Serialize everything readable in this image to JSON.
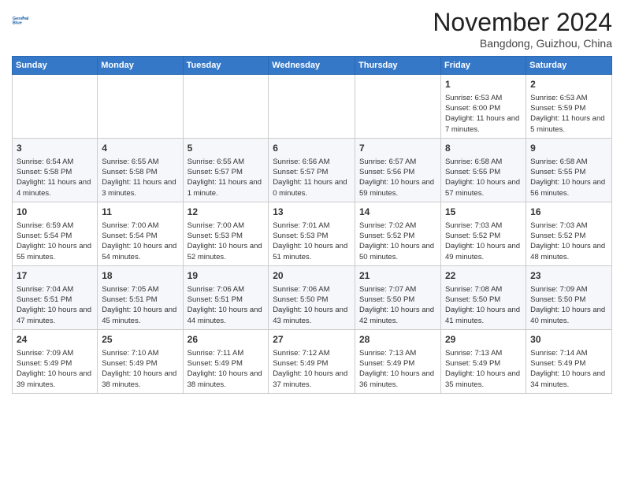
{
  "logo": {
    "line1": "General",
    "line2": "Blue"
  },
  "title": "November 2024",
  "location": "Bangdong, Guizhou, China",
  "weekdays": [
    "Sunday",
    "Monday",
    "Tuesday",
    "Wednesday",
    "Thursday",
    "Friday",
    "Saturday"
  ],
  "weeks": [
    [
      {
        "day": "",
        "empty": true
      },
      {
        "day": "",
        "empty": true
      },
      {
        "day": "",
        "empty": true
      },
      {
        "day": "",
        "empty": true
      },
      {
        "day": "",
        "empty": true
      },
      {
        "day": "1",
        "sunrise": "6:53 AM",
        "sunset": "6:00 PM",
        "daylight": "11 hours and 7 minutes."
      },
      {
        "day": "2",
        "sunrise": "6:53 AM",
        "sunset": "5:59 PM",
        "daylight": "11 hours and 5 minutes."
      }
    ],
    [
      {
        "day": "3",
        "sunrise": "6:54 AM",
        "sunset": "5:58 PM",
        "daylight": "11 hours and 4 minutes."
      },
      {
        "day": "4",
        "sunrise": "6:55 AM",
        "sunset": "5:58 PM",
        "daylight": "11 hours and 3 minutes."
      },
      {
        "day": "5",
        "sunrise": "6:55 AM",
        "sunset": "5:57 PM",
        "daylight": "11 hours and 1 minute."
      },
      {
        "day": "6",
        "sunrise": "6:56 AM",
        "sunset": "5:57 PM",
        "daylight": "11 hours and 0 minutes."
      },
      {
        "day": "7",
        "sunrise": "6:57 AM",
        "sunset": "5:56 PM",
        "daylight": "10 hours and 59 minutes."
      },
      {
        "day": "8",
        "sunrise": "6:58 AM",
        "sunset": "5:55 PM",
        "daylight": "10 hours and 57 minutes."
      },
      {
        "day": "9",
        "sunrise": "6:58 AM",
        "sunset": "5:55 PM",
        "daylight": "10 hours and 56 minutes."
      }
    ],
    [
      {
        "day": "10",
        "sunrise": "6:59 AM",
        "sunset": "5:54 PM",
        "daylight": "10 hours and 55 minutes."
      },
      {
        "day": "11",
        "sunrise": "7:00 AM",
        "sunset": "5:54 PM",
        "daylight": "10 hours and 54 minutes."
      },
      {
        "day": "12",
        "sunrise": "7:00 AM",
        "sunset": "5:53 PM",
        "daylight": "10 hours and 52 minutes."
      },
      {
        "day": "13",
        "sunrise": "7:01 AM",
        "sunset": "5:53 PM",
        "daylight": "10 hours and 51 minutes."
      },
      {
        "day": "14",
        "sunrise": "7:02 AM",
        "sunset": "5:52 PM",
        "daylight": "10 hours and 50 minutes."
      },
      {
        "day": "15",
        "sunrise": "7:03 AM",
        "sunset": "5:52 PM",
        "daylight": "10 hours and 49 minutes."
      },
      {
        "day": "16",
        "sunrise": "7:03 AM",
        "sunset": "5:52 PM",
        "daylight": "10 hours and 48 minutes."
      }
    ],
    [
      {
        "day": "17",
        "sunrise": "7:04 AM",
        "sunset": "5:51 PM",
        "daylight": "10 hours and 47 minutes."
      },
      {
        "day": "18",
        "sunrise": "7:05 AM",
        "sunset": "5:51 PM",
        "daylight": "10 hours and 45 minutes."
      },
      {
        "day": "19",
        "sunrise": "7:06 AM",
        "sunset": "5:51 PM",
        "daylight": "10 hours and 44 minutes."
      },
      {
        "day": "20",
        "sunrise": "7:06 AM",
        "sunset": "5:50 PM",
        "daylight": "10 hours and 43 minutes."
      },
      {
        "day": "21",
        "sunrise": "7:07 AM",
        "sunset": "5:50 PM",
        "daylight": "10 hours and 42 minutes."
      },
      {
        "day": "22",
        "sunrise": "7:08 AM",
        "sunset": "5:50 PM",
        "daylight": "10 hours and 41 minutes."
      },
      {
        "day": "23",
        "sunrise": "7:09 AM",
        "sunset": "5:50 PM",
        "daylight": "10 hours and 40 minutes."
      }
    ],
    [
      {
        "day": "24",
        "sunrise": "7:09 AM",
        "sunset": "5:49 PM",
        "daylight": "10 hours and 39 minutes."
      },
      {
        "day": "25",
        "sunrise": "7:10 AM",
        "sunset": "5:49 PM",
        "daylight": "10 hours and 38 minutes."
      },
      {
        "day": "26",
        "sunrise": "7:11 AM",
        "sunset": "5:49 PM",
        "daylight": "10 hours and 38 minutes."
      },
      {
        "day": "27",
        "sunrise": "7:12 AM",
        "sunset": "5:49 PM",
        "daylight": "10 hours and 37 minutes."
      },
      {
        "day": "28",
        "sunrise": "7:13 AM",
        "sunset": "5:49 PM",
        "daylight": "10 hours and 36 minutes."
      },
      {
        "day": "29",
        "sunrise": "7:13 AM",
        "sunset": "5:49 PM",
        "daylight": "10 hours and 35 minutes."
      },
      {
        "day": "30",
        "sunrise": "7:14 AM",
        "sunset": "5:49 PM",
        "daylight": "10 hours and 34 minutes."
      }
    ]
  ]
}
